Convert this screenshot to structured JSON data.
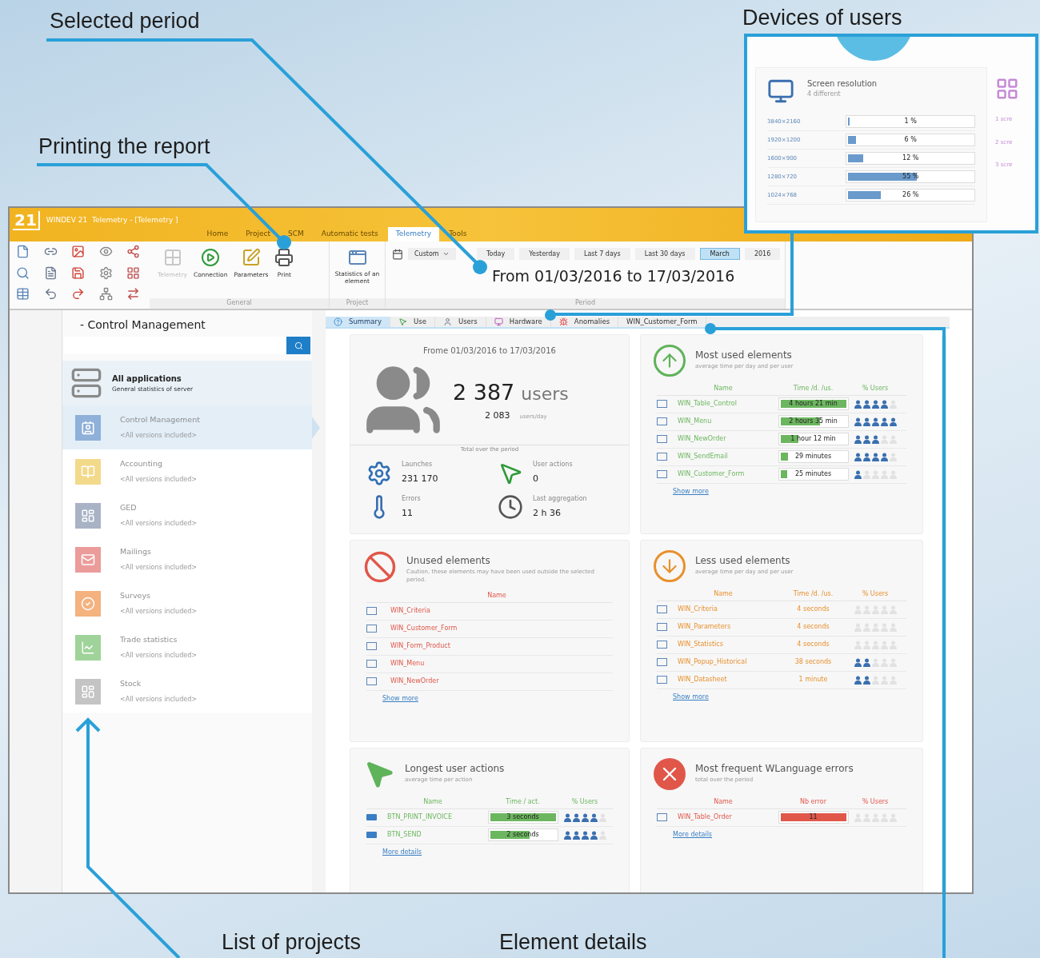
{
  "callouts": [
    {
      "label": "Selected period"
    },
    {
      "label": "Printing the report"
    },
    {
      "label": "Devices of users"
    },
    {
      "label": "List of projects"
    },
    {
      "label": "Element details"
    }
  ],
  "inset": {
    "title": "Screen resolution",
    "subtitle": "4 different",
    "rows": [
      {
        "label": "3840×2160",
        "reading": "1 %",
        "level": 0.01
      },
      {
        "label": "1920×1200",
        "reading": "6 %",
        "level": 0.06
      },
      {
        "label": "1600×900",
        "reading": "12 %",
        "level": 0.12
      },
      {
        "label": "1280×720",
        "reading": "55 %",
        "level": 0.55
      },
      {
        "label": "1024×768",
        "reading": "26 %",
        "level": 0.26
      }
    ],
    "side_items": [
      "1 scre",
      "2 scre",
      "3 scre"
    ]
  },
  "window": {
    "logo": "21",
    "title": "WINDEV 21  Telemetry - [Telemetry ]",
    "menu_tabs": [
      {
        "label": "Home",
        "selected": false
      },
      {
        "label": "Project",
        "selected": false
      },
      {
        "label": "SCM",
        "selected": false
      },
      {
        "label": "Automatic tests",
        "selected": false
      },
      {
        "label": "Telemetry",
        "selected": true
      },
      {
        "label": "Tools",
        "selected": false
      }
    ]
  },
  "ribbon": {
    "general_buttons": [
      {
        "label": "Telemetry",
        "disabled": true
      },
      {
        "label": "Connection",
        "disabled": false
      },
      {
        "label": "Parameters",
        "disabled": false
      },
      {
        "label": "Print",
        "disabled": false
      }
    ],
    "general_label": "General",
    "project_button": "Statistics of an element",
    "project_label": "Project",
    "custom_dropdown": "Custom",
    "period_buttons": [
      {
        "label": "Today",
        "selected": false
      },
      {
        "label": "Yesterday",
        "selected": false
      },
      {
        "label": "Last 7 days",
        "selected": false
      },
      {
        "label": "Last 30 days",
        "selected": false
      },
      {
        "label": "March",
        "selected": true
      },
      {
        "label": "2016",
        "selected": false
      }
    ],
    "period_text": "From 01/03/2016 to 17/03/2016",
    "period_label": "Period"
  },
  "sidebar": {
    "title": "- Control Management",
    "all": {
      "title": "All applications",
      "subtitle": "General statistics of server"
    },
    "items": [
      {
        "name": "Control Management",
        "versions": "<All versions included>",
        "color": "#8fb0d8",
        "selected": true
      },
      {
        "name": "Accounting",
        "versions": "<All versions included>",
        "color": "#f3d98a",
        "selected": false
      },
      {
        "name": "GED",
        "versions": "<All versions included>",
        "color": "#a9b3c6",
        "selected": false
      },
      {
        "name": "Mailings",
        "versions": "<All versions included>",
        "color": "#ec9b9b",
        "selected": false
      },
      {
        "name": "Surveys",
        "versions": "<All versions included>",
        "color": "#f4b27f",
        "selected": false
      },
      {
        "name": "Trade statistics",
        "versions": "<All versions included>",
        "color": "#9fd39a",
        "selected": false
      },
      {
        "name": "Stock",
        "versions": "<All versions included>",
        "color": "#c4c4c4",
        "selected": false
      }
    ]
  },
  "content_tabs": [
    {
      "label": "Summary",
      "selected": true
    },
    {
      "label": "Use",
      "selected": false
    },
    {
      "label": "Users",
      "selected": false
    },
    {
      "label": "Hardware",
      "selected": false
    },
    {
      "label": "Anomalies",
      "selected": false
    },
    {
      "label": "WIN_Customer_Form",
      "selected": false
    }
  ],
  "summary": {
    "period": "Frome 01/03/2016 to 17/03/2016",
    "users": "2 387",
    "users_unit": "users",
    "per_day": "2 083",
    "per_day_unit": "users/day",
    "total_label": "Total over the period",
    "stats": [
      {
        "label": "Launches",
        "value": "231 170"
      },
      {
        "label": "User actions",
        "value": "0"
      },
      {
        "label": "Errors",
        "value": "11"
      },
      {
        "label": "Last aggregation",
        "value": "2 h 36"
      }
    ]
  },
  "most_used": {
    "title": "Most used elements",
    "subtitle": "average time per day and per user",
    "columns": [
      "Name",
      "Time /d. /us.",
      "% Users"
    ],
    "rows": [
      {
        "name": "WIN_Table_Control",
        "time": "4 hours 21 min",
        "level": 1,
        "stars": 4
      },
      {
        "name": "WIN_Menu",
        "time": "2 hours 35 min",
        "level": 0.6,
        "stars": 5
      },
      {
        "name": "WIN_NewOrder",
        "time": "1 hour 12 min",
        "level": 0.27,
        "stars": 3
      },
      {
        "name": "WIN_SendEmail",
        "time": "29 minutes",
        "level": 0.11,
        "stars": 4
      },
      {
        "name": "WIN_Customer_Form",
        "time": "25 minutes",
        "level": 0.1,
        "stars": 1
      }
    ],
    "link": "Show more"
  },
  "unused": {
    "title": "Unused elements",
    "subtitle": "Caution, these elements may have been used outside the selected period.",
    "columns": [
      "Name"
    ],
    "rows": [
      {
        "name": "WIN_Criteria"
      },
      {
        "name": "WIN_Customer_Form"
      },
      {
        "name": "WIN_Form_Product"
      },
      {
        "name": "WIN_Menu"
      },
      {
        "name": "WIN_NewOrder"
      }
    ],
    "link": "Show more"
  },
  "less_used": {
    "title": "Less used elements",
    "subtitle": "average time per day and per user",
    "columns": [
      "Name",
      "Time /d. /us.",
      "% Users"
    ],
    "rows": [
      {
        "name": "WIN_Criteria",
        "time": "4 seconds",
        "stars": 0
      },
      {
        "name": "WIN_Parameters",
        "time": "4 seconds",
        "stars": 0
      },
      {
        "name": "WIN_Statistics",
        "time": "4 seconds",
        "stars": 0
      },
      {
        "name": "WIN_Popup_Historical",
        "time": "38 seconds",
        "stars": 2
      },
      {
        "name": "WIN_Datasheet",
        "time": "1 minute",
        "stars": 2
      }
    ],
    "link": "Show more"
  },
  "longest": {
    "title": "Longest user actions",
    "subtitle": "average time per action",
    "columns": [
      "Name",
      "Time / act.",
      "% Users"
    ],
    "rows": [
      {
        "name": "BTN_PRINT_INVOICE",
        "time": "3 seconds",
        "level": 1,
        "stars": 4
      },
      {
        "name": "BTN_SEND",
        "time": "2 seconds",
        "level": 0.6,
        "stars": 4
      }
    ],
    "link": "More details"
  },
  "errors": {
    "title": "Most frequent WLanguage errors",
    "subtitle": "total over the period",
    "columns": [
      "Name",
      "Nb error",
      "% Users"
    ],
    "rows": [
      {
        "name": "WIN_Table_Order",
        "count": "11",
        "level": 1,
        "stars": 0
      }
    ],
    "link": "More details"
  }
}
